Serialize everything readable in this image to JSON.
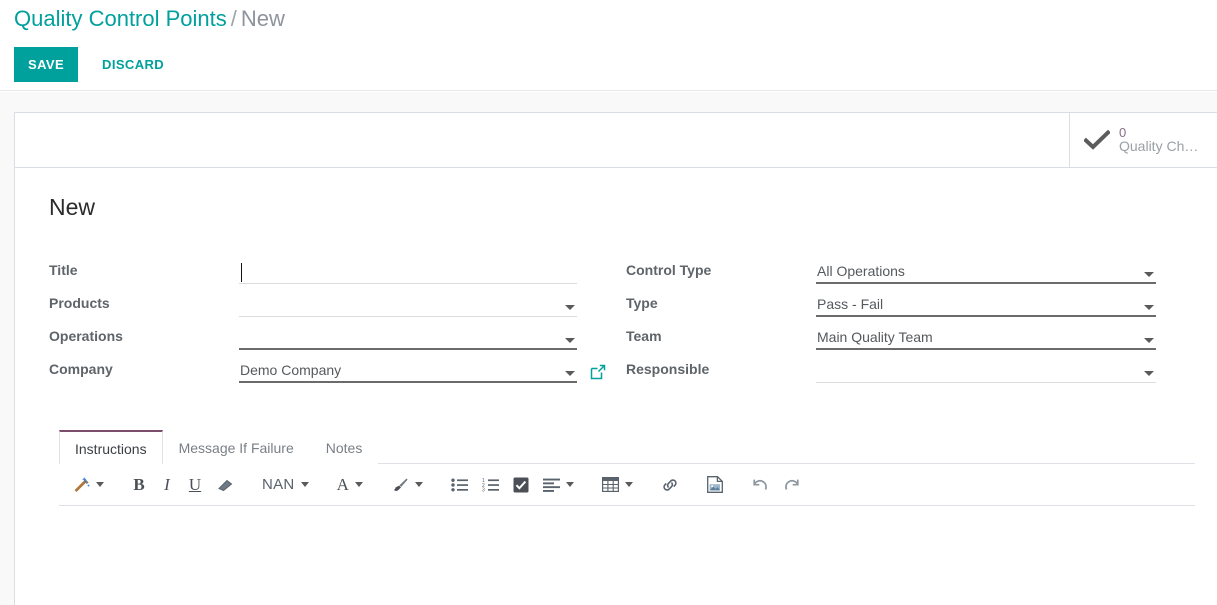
{
  "breadcrumb": {
    "root": "Quality Control Points",
    "separator": "/",
    "current": "New"
  },
  "actions": {
    "save_label": "SAVE",
    "discard_label": "DISCARD"
  },
  "stat_button": {
    "icon": "check-icon",
    "value": "0",
    "label": "Quality Ch…"
  },
  "record": {
    "title": "New"
  },
  "form": {
    "left": [
      {
        "label": "Title",
        "value": "",
        "widget": "text",
        "underline": "light",
        "caret": false,
        "cursor": true,
        "external_link": false
      },
      {
        "label": "Products",
        "value": "",
        "widget": "many2many",
        "underline": "light",
        "caret": true,
        "cursor": false,
        "external_link": false
      },
      {
        "label": "Operations",
        "value": "",
        "widget": "many2many",
        "underline": "dark",
        "caret": true,
        "cursor": false,
        "external_link": false
      },
      {
        "label": "Company",
        "value": "Demo Company",
        "widget": "many2one",
        "underline": "dark",
        "caret": true,
        "cursor": false,
        "external_link": true
      }
    ],
    "right": [
      {
        "label": "Control Type",
        "value": "All Operations",
        "widget": "select",
        "underline": "dark",
        "caret": true,
        "cursor": false,
        "external_link": false
      },
      {
        "label": "Type",
        "value": "Pass - Fail",
        "widget": "select",
        "underline": "dark",
        "caret": true,
        "cursor": false,
        "external_link": false
      },
      {
        "label": "Team",
        "value": "Main Quality Team",
        "widget": "many2one",
        "underline": "dark",
        "caret": true,
        "cursor": false,
        "external_link": false
      },
      {
        "label": "Responsible",
        "value": "",
        "widget": "many2one",
        "underline": "light",
        "caret": true,
        "cursor": false,
        "external_link": false
      }
    ]
  },
  "notebook": {
    "tabs": [
      {
        "label": "Instructions",
        "active": true
      },
      {
        "label": "Message If Failure",
        "active": false
      },
      {
        "label": "Notes",
        "active": false
      }
    ]
  },
  "editor": {
    "toolbar": [
      {
        "name": "style-magic-wand",
        "icon": "magic-wand-icon",
        "text": "",
        "caret": true,
        "gap": true
      },
      {
        "name": "bold",
        "icon": "bold-icon",
        "text": "B",
        "caret": false,
        "gap": false
      },
      {
        "name": "italic",
        "icon": "italic-icon",
        "text": "I",
        "caret": false,
        "gap": false
      },
      {
        "name": "underline",
        "icon": "underline-icon",
        "text": "U",
        "caret": false,
        "gap": false
      },
      {
        "name": "clear-format",
        "icon": "eraser-icon",
        "text": "",
        "caret": false,
        "gap": true
      },
      {
        "name": "font-size",
        "icon": "font-size-icon",
        "text": "NAN",
        "caret": true,
        "gap": true
      },
      {
        "name": "font-color",
        "icon": "font-color-icon",
        "text": "A",
        "caret": true,
        "gap": true
      },
      {
        "name": "background-color",
        "icon": "paint-brush-icon",
        "text": "",
        "caret": true,
        "gap": true
      },
      {
        "name": "unordered-list",
        "icon": "bullet-list-icon",
        "text": "",
        "caret": false,
        "gap": false
      },
      {
        "name": "ordered-list",
        "icon": "numbered-list-icon",
        "text": "",
        "caret": false,
        "gap": false
      },
      {
        "name": "checklist",
        "icon": "checkbox-icon",
        "text": "",
        "caret": false,
        "gap": false
      },
      {
        "name": "align",
        "icon": "align-left-icon",
        "text": "",
        "caret": true,
        "gap": true
      },
      {
        "name": "table",
        "icon": "table-icon",
        "text": "",
        "caret": true,
        "gap": true
      },
      {
        "name": "insert-link",
        "icon": "link-icon",
        "text": "",
        "caret": false,
        "gap": true
      },
      {
        "name": "insert-image",
        "icon": "image-icon",
        "text": "",
        "caret": false,
        "gap": true
      },
      {
        "name": "undo",
        "icon": "undo-icon",
        "text": "",
        "caret": false,
        "gap": false
      },
      {
        "name": "redo",
        "icon": "redo-icon",
        "text": "",
        "caret": false,
        "gap": false
      }
    ],
    "content": ""
  },
  "colors": {
    "accent_teal": "#00a09d",
    "brand_purple": "#8a6d8a",
    "tab_active_border": "#7d4e6b",
    "label_gray": "#5e6469",
    "value_gray": "#55595d"
  }
}
